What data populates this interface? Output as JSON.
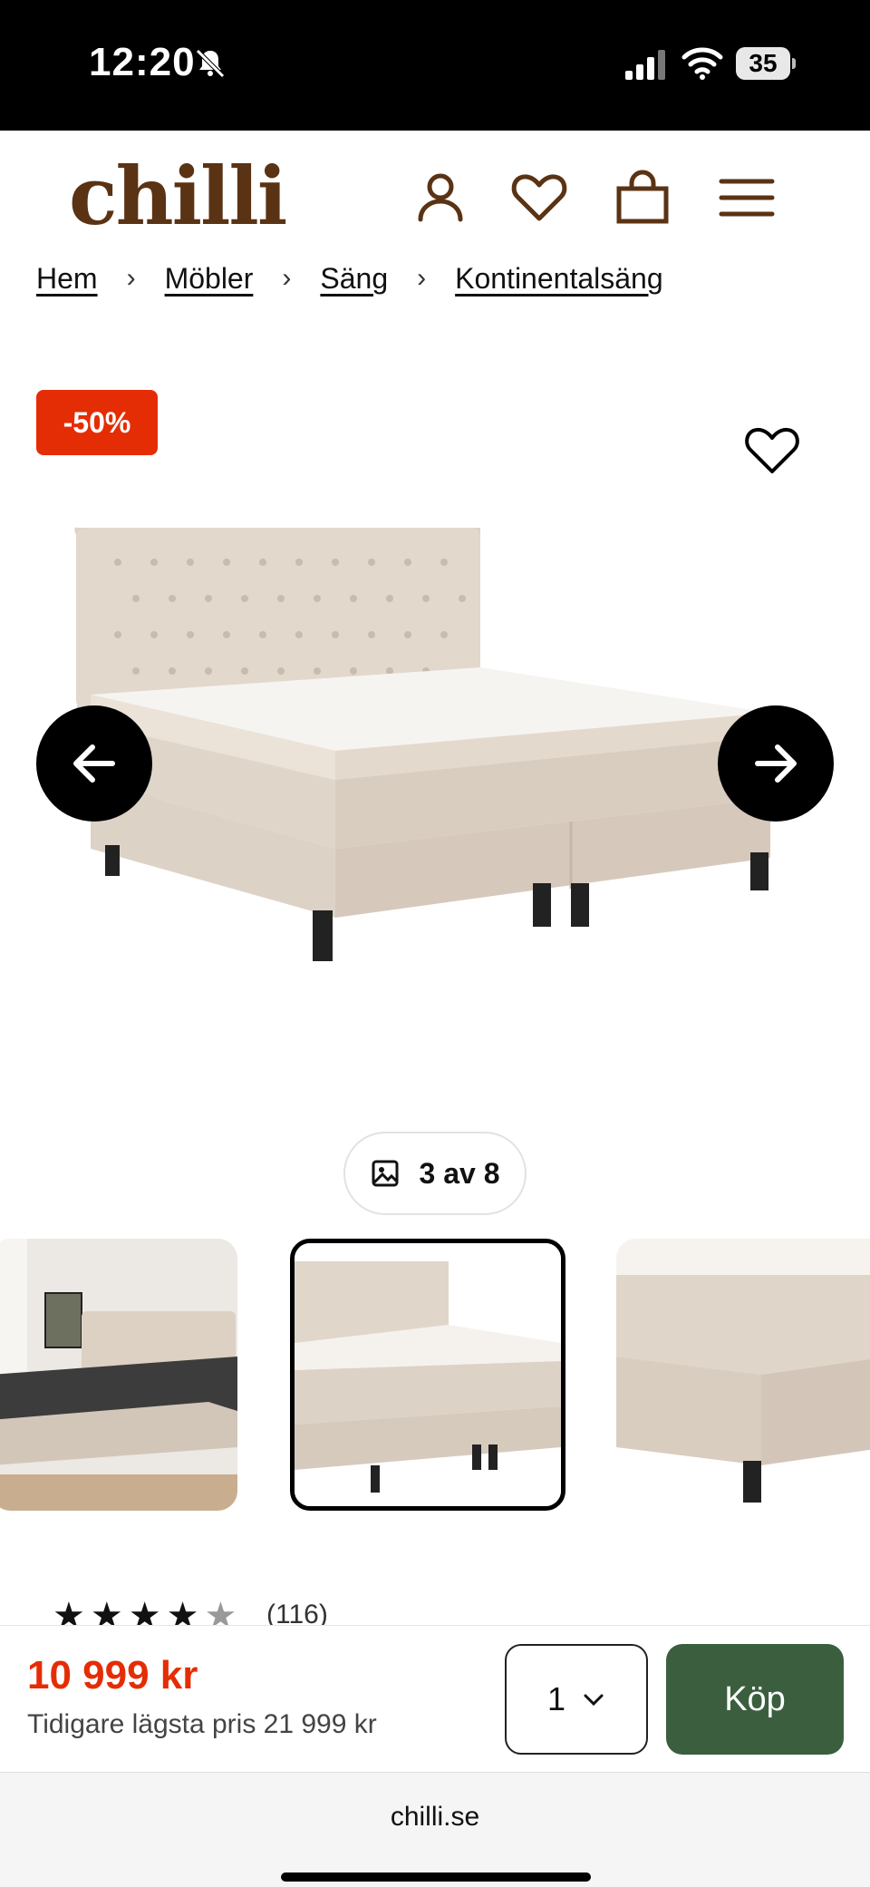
{
  "status": {
    "time": "12:20",
    "battery": "35"
  },
  "brand": {
    "logo": "chilli",
    "color": "#5a3314"
  },
  "header": {
    "icons": [
      "account-icon",
      "heart-icon",
      "bag-icon",
      "menu-icon"
    ]
  },
  "breadcrumb": [
    "Hem",
    "Möbler",
    "Säng",
    "Kontinentalsäng"
  ],
  "product": {
    "discount_badge": "-50%",
    "gallery_counter": "3 av 8",
    "rating": 4.5,
    "rating_count": "(116)"
  },
  "buy_bar": {
    "price": "10 999 kr",
    "previous_price": "Tidigare lägsta pris 21 999 kr",
    "quantity": "1",
    "buy_label": "Köp"
  },
  "browser": {
    "url": "chilli.se"
  },
  "colors": {
    "sale": "#e52d05",
    "buy": "#3b5f3e"
  }
}
